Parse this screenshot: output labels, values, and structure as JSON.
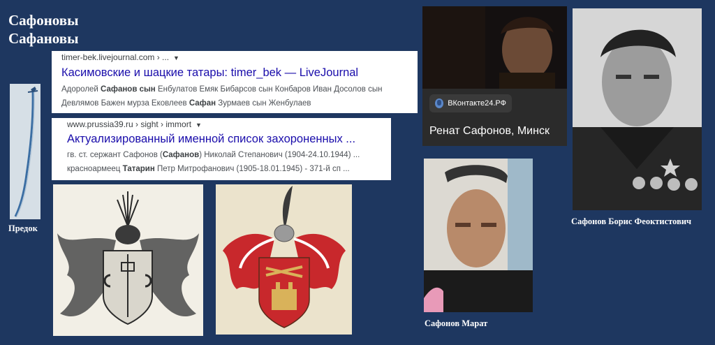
{
  "page": {
    "title_line1": "Сафоновы",
    "title_line2": "Сафановы"
  },
  "ancestor": {
    "caption": "Предок"
  },
  "results": [
    {
      "url": "timer-bek.livejournal.com › ...",
      "heading": "Касимовские и шацкие татары: timer_bek — LiveJournal",
      "line1": [
        {
          "t": "Адоролей ",
          "b": false
        },
        {
          "t": "Сафанов",
          "b": true
        },
        {
          "t": " ",
          "b": false
        },
        {
          "t": "сын",
          "b": true
        },
        {
          "t": " Енбулатов Емяк Бибарсов сын Конбаров Иван Досолов сын",
          "b": false
        }
      ],
      "line2": [
        {
          "t": "Девлямов Бажен мурза Ековлеев ",
          "b": false
        },
        {
          "t": "Сафан",
          "b": true
        },
        {
          "t": " Зурмаев сын Женбулаев",
          "b": false
        }
      ]
    },
    {
      "url": "www.prussia39.ru › sight › immort",
      "heading": "Актуализированный именной список захороненных ...",
      "line1": [
        {
          "t": "гв. ст. сержант Сафонов (",
          "b": false
        },
        {
          "t": "Сафанов",
          "b": true
        },
        {
          "t": ") Николай Степанович (1904-24.10.1944) ...",
          "b": false
        }
      ],
      "line2": [
        {
          "t": "красноармеец ",
          "b": false
        },
        {
          "t": "Татарин",
          "b": true
        },
        {
          "t": " Петр Митрофанович (1905-18.01.1945) - 371-й сп ...",
          "b": false
        }
      ]
    }
  ],
  "vk": {
    "badge": "ВКонтакте24.РФ",
    "name": "Ренат Сафонов, Минск"
  },
  "captions": {
    "marat": "Сафонов Марат",
    "boris": "Сафонов Борис Феоктистович"
  },
  "colors": {
    "background": "#1e3760",
    "link": "#1a0dab",
    "crest_red": "#c8282c",
    "crest_gold": "#d9b25a"
  }
}
